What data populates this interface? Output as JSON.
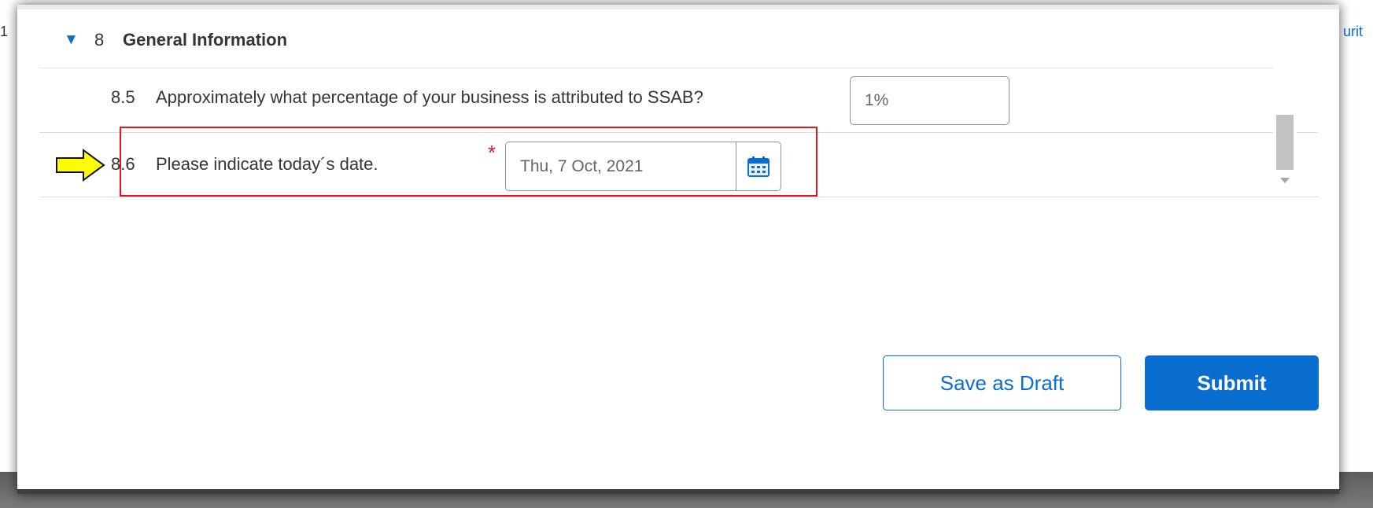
{
  "background": {
    "left_fragment": "1",
    "right_fragment": "urit"
  },
  "section": {
    "number": "8",
    "title": "General Information"
  },
  "questions": [
    {
      "number": "8.5",
      "text": "Approximately what percentage of your business is attributed to SSAB?",
      "value": "1%"
    },
    {
      "number": "8.6",
      "text": "Please indicate today´s date.",
      "required_mark": "*",
      "value": "Thu, 7 Oct, 2021"
    }
  ],
  "buttons": {
    "save_draft": "Save as Draft",
    "submit": "Submit"
  },
  "colors": {
    "accent": "#0a6ed1",
    "highlight": "#e3141b",
    "arrow_fill": "#ffff00",
    "required": "#d32030"
  }
}
